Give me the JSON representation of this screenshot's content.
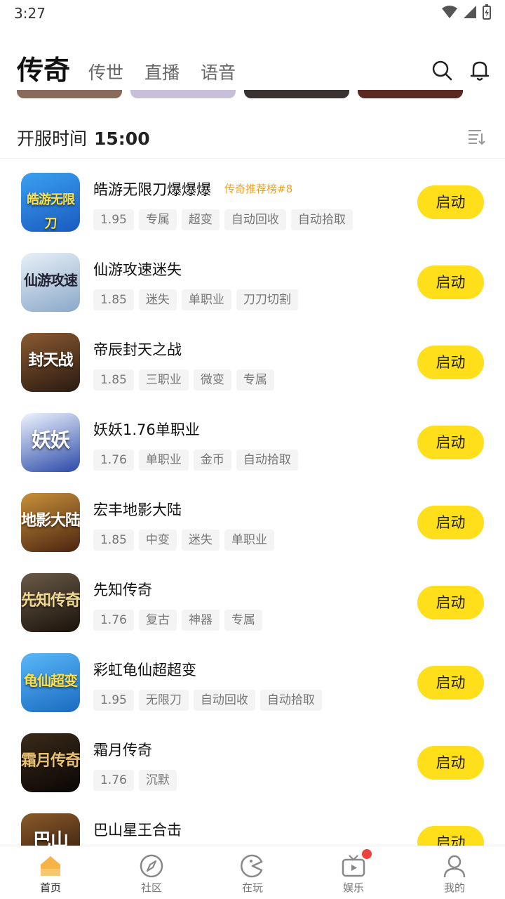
{
  "status_bar": {
    "time": "3:27"
  },
  "top_nav": {
    "tabs": [
      {
        "label": "传奇",
        "active": true
      },
      {
        "label": "传世",
        "active": false
      },
      {
        "label": "直播",
        "active": false
      },
      {
        "label": "语音",
        "active": false
      }
    ],
    "icons": [
      "search-icon",
      "bell-icon"
    ]
  },
  "server": {
    "label": "开服时间",
    "time": "15:00",
    "sort_icon": "sort-icon"
  },
  "accent_color": "#ffde1a",
  "games": [
    {
      "name": "皓游无限刀爆爆爆",
      "rank": "传奇推荐榜#8",
      "tags": [
        "1.95",
        "专属",
        "超变",
        "自动回收",
        "自动拾取"
      ],
      "button": "启动",
      "icon_text": "皓游无限刀",
      "icon_color": "#1a78d0"
    },
    {
      "name": "仙游攻速迷失",
      "rank": "",
      "tags": [
        "1.85",
        "迷失",
        "单职业",
        "刀刀切割"
      ],
      "button": "启动",
      "icon_text": "仙游攻速",
      "icon_color": "#b8d0e8"
    },
    {
      "name": "帝辰封天之战",
      "rank": "",
      "tags": [
        "1.85",
        "三职业",
        "微变",
        "专属"
      ],
      "button": "启动",
      "icon_text": "封天战",
      "icon_color": "#5a3a22"
    },
    {
      "name": "妖妖1.76单职业",
      "rank": "",
      "tags": [
        "1.76",
        "单职业",
        "金币",
        "自动拾取"
      ],
      "button": "启动",
      "icon_text": "妖妖",
      "icon_color": "#2a4aa8"
    },
    {
      "name": "宏丰地影大陆",
      "rank": "",
      "tags": [
        "1.85",
        "中变",
        "迷失",
        "单职业"
      ],
      "button": "启动",
      "icon_text": "地影大陆",
      "icon_color": "#6a3a18"
    },
    {
      "name": "先知传奇",
      "rank": "",
      "tags": [
        "1.76",
        "复古",
        "神器",
        "专属"
      ],
      "button": "启动",
      "icon_text": "先知传奇",
      "icon_color": "#3a2a1a"
    },
    {
      "name": "彩虹龟仙超超变",
      "rank": "",
      "tags": [
        "1.95",
        "无限刀",
        "自动回收",
        "自动拾取"
      ],
      "button": "启动",
      "icon_text": "龟仙超变",
      "icon_color": "#2a8ad8"
    },
    {
      "name": "霜月传奇",
      "rank": "",
      "tags": [
        "1.76",
        "沉默"
      ],
      "button": "启动",
      "icon_text": "霜月传奇",
      "icon_color": "#2a1a10"
    },
    {
      "name": "巴山星王合击",
      "rank": "",
      "tags": [],
      "button": "启动",
      "icon_text": "巴山",
      "icon_color": "#4a2a14"
    }
  ],
  "bottom_nav": [
    {
      "label": "首页",
      "icon": "home-icon",
      "active": true,
      "badge": false
    },
    {
      "label": "社区",
      "icon": "compass-icon",
      "active": false,
      "badge": false
    },
    {
      "label": "在玩",
      "icon": "pacman-icon",
      "active": false,
      "badge": false
    },
    {
      "label": "娱乐",
      "icon": "tv-icon",
      "active": false,
      "badge": true
    },
    {
      "label": "我的",
      "icon": "user-icon",
      "active": false,
      "badge": false
    }
  ]
}
